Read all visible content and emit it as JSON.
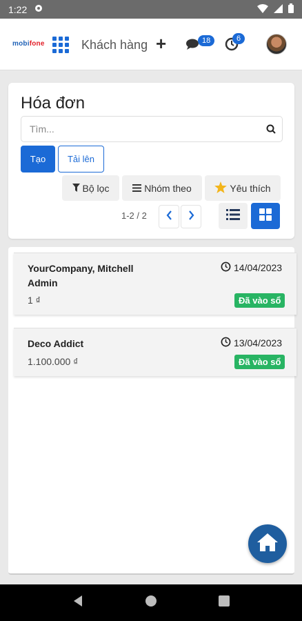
{
  "status_bar": {
    "time": "1:22"
  },
  "header": {
    "logo": {
      "left": "mobi",
      "right": "fone"
    },
    "menu_title": "Khách hàng",
    "messages_count": "18",
    "activities_count": "6"
  },
  "control_panel": {
    "title": "Hóa đơn",
    "search_placeholder": "Tìm...",
    "create_label": "Tạo",
    "upload_label": "Tải lên",
    "filter_label": "Bộ lọc",
    "group_label": "Nhóm theo",
    "favorites_label": "Yêu thích",
    "pager_text": "1-2 / 2"
  },
  "invoices": [
    {
      "partner": "YourCompany, Mitchell Admin",
      "date": "14/04/2023",
      "amount": "1 ₫",
      "status": "Đã vào sổ"
    },
    {
      "partner": "Deco Addict",
      "date": "13/04/2023",
      "amount": "1.100.000 ₫",
      "status": "Đã vào sổ"
    }
  ],
  "colors": {
    "primary": "#1b6ad6",
    "success": "#28b463",
    "fab": "#1f5e9f"
  }
}
